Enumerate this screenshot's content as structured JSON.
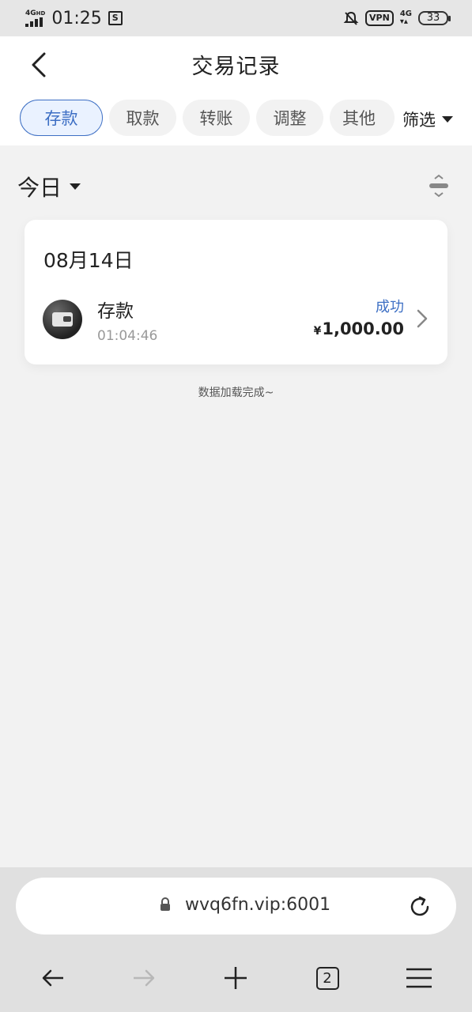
{
  "status_bar": {
    "network": "4G",
    "network_sub": "HD",
    "time": "01:25",
    "vpn": "VPN",
    "mobile_data": "4G",
    "battery": "33"
  },
  "header": {
    "title": "交易记录",
    "tabs": [
      {
        "label": "存款",
        "active": true
      },
      {
        "label": "取款",
        "active": false
      },
      {
        "label": "转账",
        "active": false
      },
      {
        "label": "调整",
        "active": false
      },
      {
        "label": "其他",
        "active": false
      }
    ],
    "filter_label": "筛选"
  },
  "period": {
    "label": "今日"
  },
  "transactions": [
    {
      "date": "08月14日",
      "type": "存款",
      "time": "01:04:46",
      "status": "成功",
      "currency": "¥",
      "amount": "1,000.00"
    }
  ],
  "list_footer": "数据加载完成~",
  "browser": {
    "url": "wvq6fn.vip:6001",
    "tab_count": "2"
  },
  "colors": {
    "accent": "#3d6fc4",
    "background": "#f2f2f2"
  }
}
